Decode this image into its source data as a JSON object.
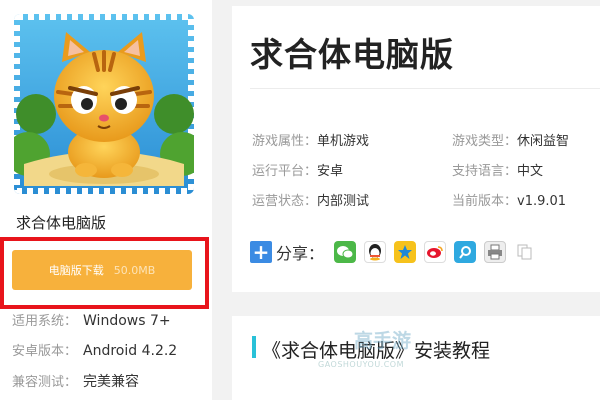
{
  "game": {
    "name": "求合体电脑版"
  },
  "download": {
    "label": "电脑版下载",
    "size": "50.0MB"
  },
  "specs": [
    {
      "label": "适用系统：",
      "value": "Windows 7+"
    },
    {
      "label": "安卓版本：",
      "value": "Android 4.2.2"
    },
    {
      "label": "兼容测试：",
      "value": "完美兼容"
    }
  ],
  "header": {
    "title": "求合体电脑版"
  },
  "attributes": [
    {
      "label": "游戏属性：",
      "value": "单机游戏"
    },
    {
      "label": "游戏类型：",
      "value": "休闲益智"
    },
    {
      "label": "运行平台：",
      "value": "安卓"
    },
    {
      "label": "支持语言：",
      "value": "中文"
    },
    {
      "label": "运营状态：",
      "value": "内部测试"
    },
    {
      "label": "当前版本：",
      "value": "v1.9.01"
    }
  ],
  "share": {
    "label": "分享：",
    "icons": [
      "wechat-icon",
      "qq-icon",
      "qzone-icon",
      "weibo-icon",
      "tencent-weibo-icon",
      "print-icon",
      "copy-icon"
    ]
  },
  "section": {
    "title": "《求合体电脑版》安装教程"
  },
  "watermark": {
    "text": "高手游",
    "url": "GAOSHOUYOU.COM"
  },
  "colors": {
    "download": "#f7b13c",
    "highlight": "#e8141b",
    "section_bar": "#29c1d8",
    "share_plus": "#3b8be3"
  }
}
